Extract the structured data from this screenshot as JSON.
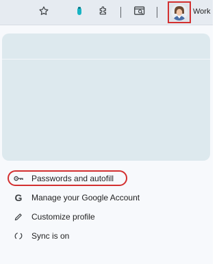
{
  "toolbar": {
    "icons": [
      "star-icon",
      "extension-dot-icon",
      "puzzle-icon",
      "tab-search-icon",
      "avatar"
    ],
    "profile_label": "Work",
    "accent_highlight": "#d32f2f"
  },
  "menu": {
    "items": [
      {
        "label": "Passwords and autofill",
        "icon": "key-icon"
      },
      {
        "label": "Manage your Google Account",
        "icon": "google-g-icon"
      },
      {
        "label": "Customize profile",
        "icon": "pencil-icon"
      },
      {
        "label": "Sync is on",
        "icon": "sync-icon"
      }
    ]
  }
}
